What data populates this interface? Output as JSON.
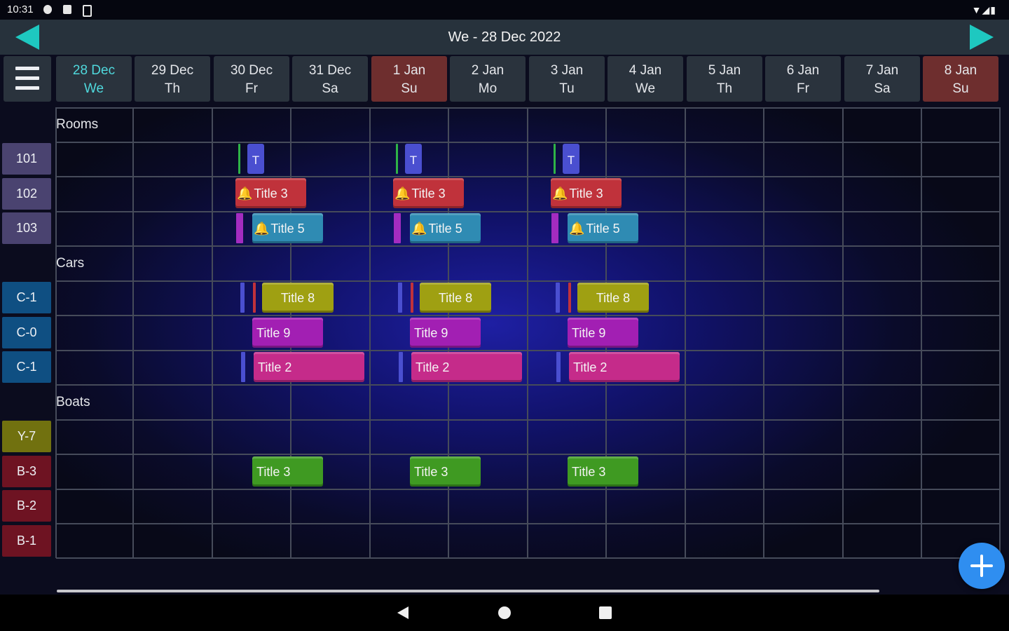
{
  "status_bar": {
    "time": "10:31",
    "left_icons": [
      "chat-icon",
      "sd-card-icon",
      "battery-saver-icon"
    ],
    "right_icons": [
      "wifi-icon",
      "signal-icon",
      "battery-icon"
    ]
  },
  "header": {
    "title": "We - 28 Dec 2022"
  },
  "days": [
    {
      "date": "28 Dec",
      "weekday": "We"
    },
    {
      "date": "29 Dec",
      "weekday": "Th"
    },
    {
      "date": "30 Dec",
      "weekday": "Fr"
    },
    {
      "date": "31 Dec",
      "weekday": "Sa"
    },
    {
      "date": "1 Jan",
      "weekday": "Su"
    },
    {
      "date": "2 Jan",
      "weekday": "Mo"
    },
    {
      "date": "3 Jan",
      "weekday": "Tu"
    },
    {
      "date": "4 Jan",
      "weekday": "We"
    },
    {
      "date": "5 Jan",
      "weekday": "Th"
    },
    {
      "date": "6 Jan",
      "weekday": "Fr"
    },
    {
      "date": "7 Jan",
      "weekday": "Sa"
    },
    {
      "date": "8 Jan",
      "weekday": "Su"
    }
  ],
  "groups": [
    {
      "label": "Rooms",
      "resources": [
        "101",
        "102",
        "103"
      ]
    },
    {
      "label": "Cars",
      "resources": [
        "C-1",
        "C-0",
        "C-1"
      ]
    },
    {
      "label": "Boats",
      "resources": [
        "Y-7",
        "B-3",
        "B-2",
        "B-1"
      ]
    }
  ],
  "events": {
    "t_marker": "T",
    "room_102": "Title 3",
    "room_103": "Title 5",
    "car_c1": "Title 8",
    "car_c0": "Title 9",
    "car_c1b": "Title 2",
    "boat_b3": "Title 3"
  },
  "colors": {
    "accent": "#1ec8c0",
    "today": "#4fd8dc",
    "weekend": "#6e2e2e",
    "fab": "#2f8ef0",
    "title_3_room": "#c0323b",
    "title_5": "#2f8bb3",
    "title_8": "#9fa012",
    "title_9": "#a21fb3",
    "title_2": "#c52b8a",
    "title_3_boat": "#3f9a22"
  }
}
